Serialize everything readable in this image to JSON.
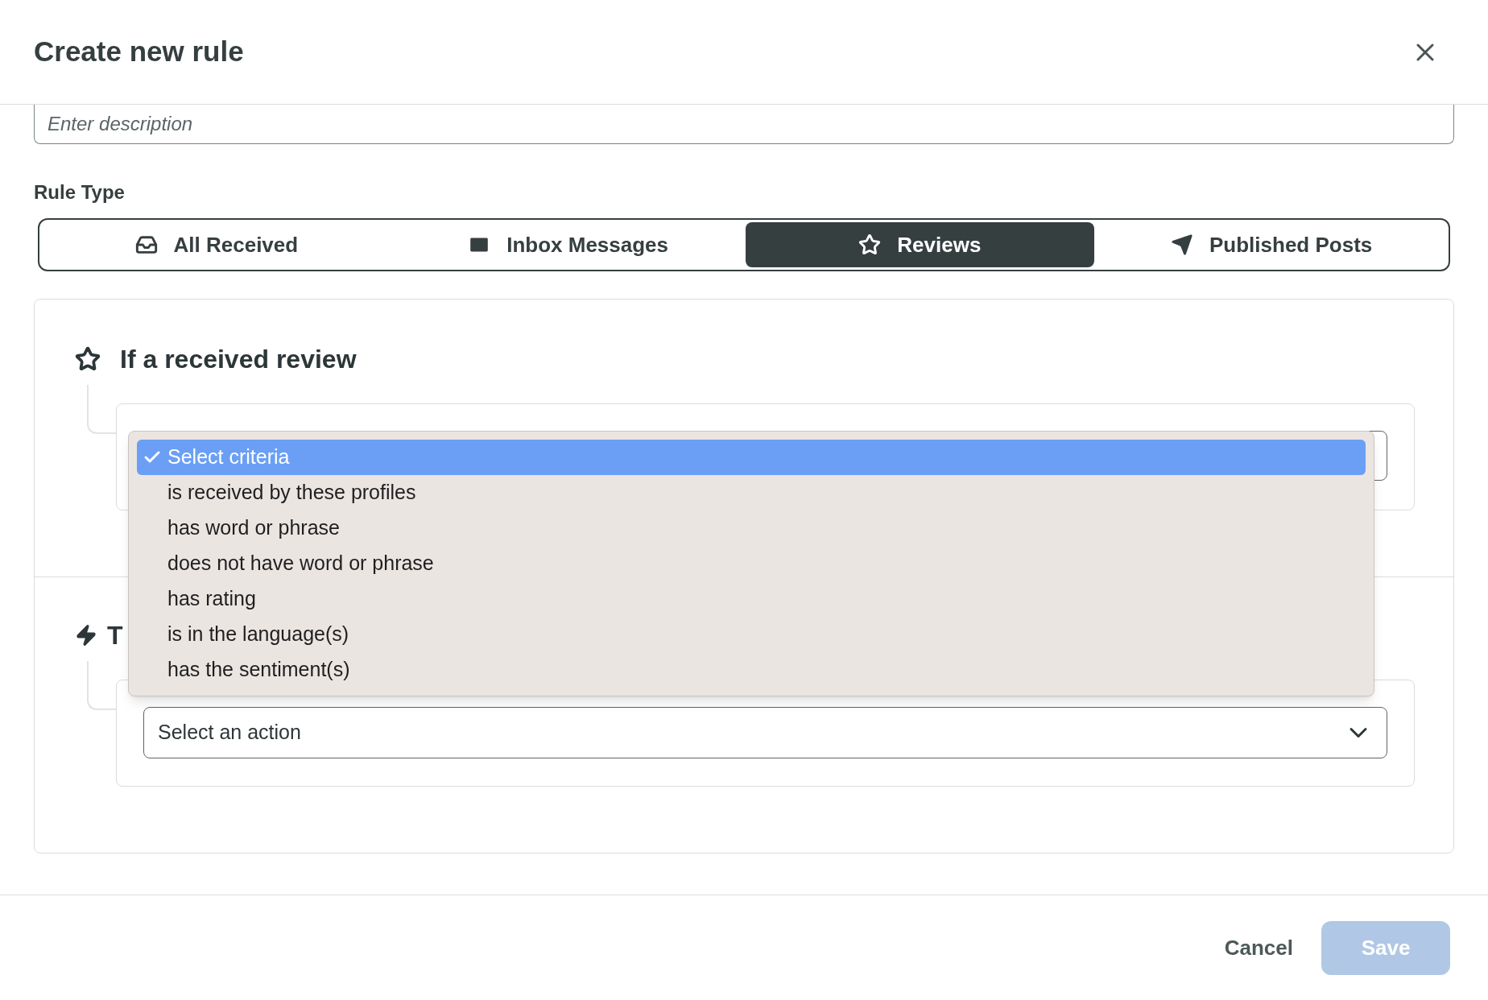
{
  "dialog": {
    "title": "Create new rule"
  },
  "description": {
    "placeholder": "Enter description"
  },
  "rule_type": {
    "label": "Rule Type",
    "tabs": [
      {
        "label": "All Received",
        "selected": false
      },
      {
        "label": "Inbox Messages",
        "selected": false
      },
      {
        "label": "Reviews",
        "selected": true
      },
      {
        "label": "Published Posts",
        "selected": false
      }
    ]
  },
  "condition": {
    "title": "If a received review",
    "dropdown": [
      {
        "label": "Select criteria",
        "selected": true
      },
      {
        "label": "is received by these profiles",
        "selected": false
      },
      {
        "label": "has word or phrase",
        "selected": false
      },
      {
        "label": "does not have word or phrase",
        "selected": false
      },
      {
        "label": "has rating",
        "selected": false
      },
      {
        "label": "is in the language(s)",
        "selected": false
      },
      {
        "label": "has the sentiment(s)",
        "selected": false
      }
    ]
  },
  "action": {
    "title": "T",
    "select": {
      "placeholder": "Select an action"
    }
  },
  "footer": {
    "cancel": "Cancel",
    "save": {
      "label": "Save",
      "disabled": true
    }
  }
}
